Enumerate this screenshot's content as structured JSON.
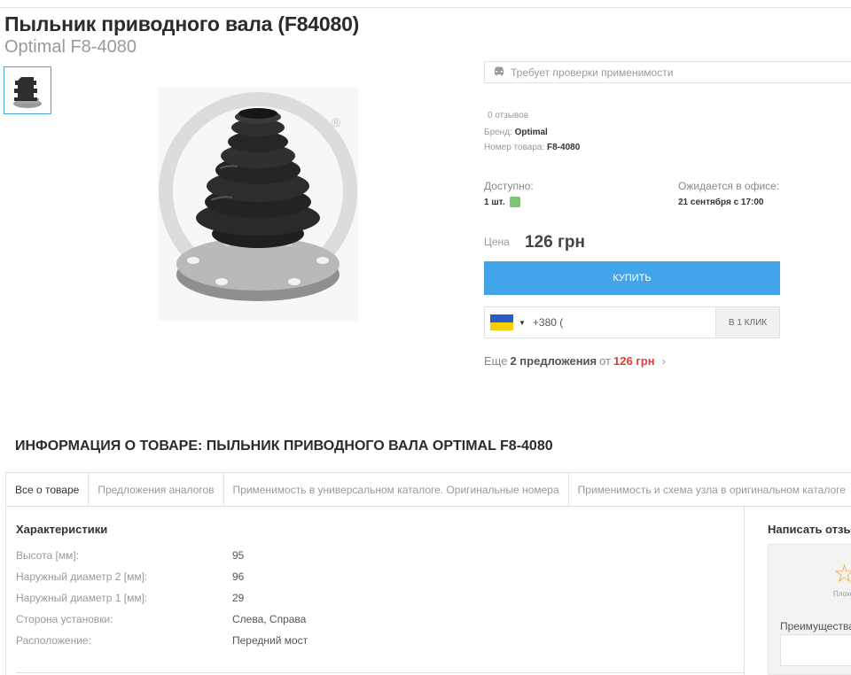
{
  "product": {
    "title": "Пыльник приводного вала (F84080)",
    "subtitle": "Optimal F8-4080",
    "applicability": "Требует проверки применимости",
    "reviews": "0 отзывов",
    "brand_label": "Бренд:",
    "brand_value": "Optimal",
    "partno_label": "Номер товара:",
    "partno_value": "F8-4080",
    "available_label": "Доступно:",
    "available_value": "1 шт.",
    "expected_label": "Ожидается в офисе:",
    "expected_value": "21 сентября с 17:00",
    "price_label": "Цена",
    "price_value": "126 грн",
    "buy_label": "купить",
    "phone_prefix": "+380 (",
    "oneclick_label": "в 1 клик",
    "offers_prefix": "Еще",
    "offers_count": "2 предложения",
    "offers_from": "от",
    "offers_price": "126 грн"
  },
  "info": {
    "heading": "Информация о товаре: Пыльник приводного вала OPTIMAL F8-4080",
    "tabs": [
      {
        "label": "Все о товаре"
      },
      {
        "label": "Предложения аналогов"
      },
      {
        "label": "Применимость в универсальном каталоге. Оригинальные номера"
      },
      {
        "label": "Применимость и схема узла в оригинальном каталоге"
      }
    ],
    "characteristics_title": "Характеристики",
    "specs": [
      {
        "label": "Высота [мм]:",
        "value": "95"
      },
      {
        "label": "Наружный диаметр 2 [мм]:",
        "value": "96"
      },
      {
        "label": "Наружный диаметр 1 [мм]:",
        "value": "29"
      },
      {
        "label": "Сторона установки:",
        "value": "Слева, Справа"
      },
      {
        "label": "Расположение:",
        "value": "Передний мост"
      }
    ]
  },
  "review_form": {
    "title": "Написать отзыв",
    "rating_label": "Плохо",
    "pros_label": "Преимущества"
  },
  "colors": {
    "accent": "#42a5ea",
    "price_red": "#e23b3b",
    "available_green": "#7cc576"
  }
}
